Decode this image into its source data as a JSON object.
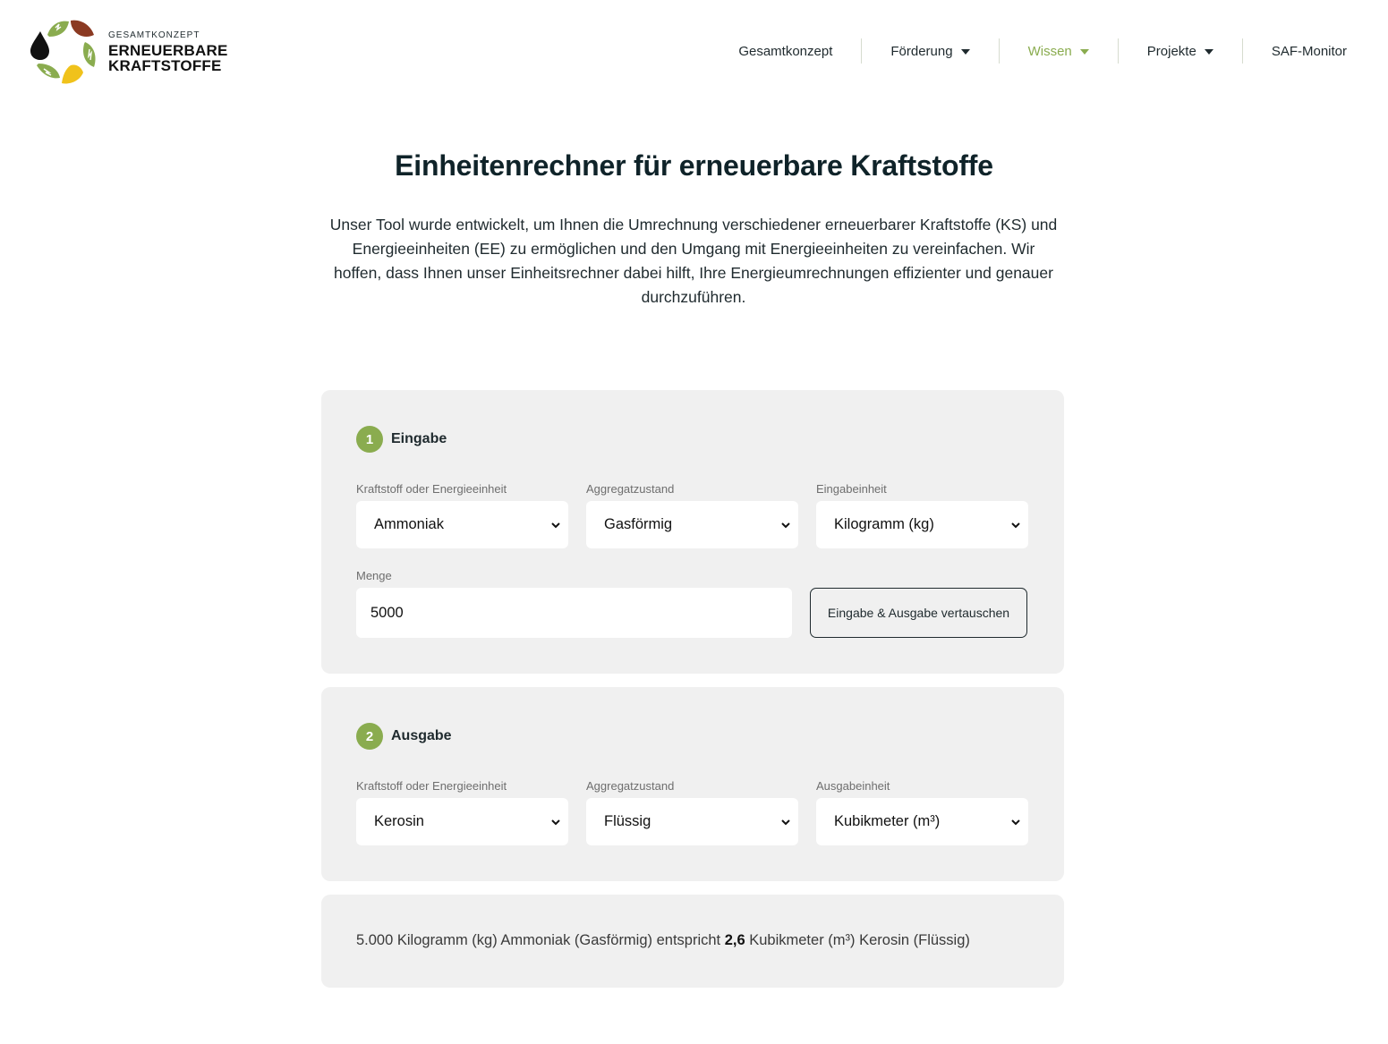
{
  "header": {
    "logo": {
      "small_text": "GESAMTKONZEPT",
      "line1": "ERNEUERBARE",
      "line2": "KRAFTSTOFFE"
    },
    "nav": [
      {
        "label": "Gesamtkonzept",
        "dropdown": false,
        "active": false
      },
      {
        "label": "Förderung",
        "dropdown": true,
        "active": false
      },
      {
        "label": "Wissen",
        "dropdown": true,
        "active": true
      },
      {
        "label": "Projekte",
        "dropdown": true,
        "active": false
      },
      {
        "label": "SAF-Monitor",
        "dropdown": false,
        "active": false
      }
    ]
  },
  "hero": {
    "title": "Einheitenrechner für erneuerbare Kraftstoffe",
    "intro_lines": [
      "Unser Tool wurde entwickelt, um Ihnen die Umrechnung verschiedener erneuerbarer Kraftstoffe (KS) und",
      "Energieeinheiten (EE) zu ermöglichen und den Umgang mit Energieeinheiten zu vereinfachen. Wir",
      "hoffen, dass Ihnen unser Einheitsrechner dabei hilft, Ihre Energieumrechnungen effizienter und genauer",
      "durchzuführen."
    ]
  },
  "input_section": {
    "step_number": "1",
    "step_label": "Eingabe",
    "fuel_label": "Kraftstoff oder Energieeinheit",
    "fuel_value": "Ammoniak",
    "state_label": "Aggregatzustand",
    "state_value": "Gasförmig",
    "unit_label": "Eingabeinheit",
    "unit_value": "Kilogramm (kg)",
    "amount_label": "Menge",
    "amount_value": "5000",
    "swap_button": "Eingabe & Ausgabe vertauschen"
  },
  "output_section": {
    "step_number": "2",
    "step_label": "Ausgabe",
    "fuel_label": "Kraftstoff oder Energieeinheit",
    "fuel_value": "Kerosin",
    "state_label": "Aggregatzustand",
    "state_value": "Flüssig",
    "unit_label": "Ausgabeinheit",
    "unit_value": "Kubikmeter (m³)"
  },
  "result": {
    "prefix": "5.000 Kilogramm (kg) Ammoniak (Gasförmig) entspricht ",
    "value": "2,6",
    "suffix": " Kubikmeter (m³) Kerosin (Flüssig)"
  },
  "colors": {
    "accent_green": "#8aac4f",
    "panel_bg": "#f0f0f0",
    "text_dark": "#0f2329"
  }
}
